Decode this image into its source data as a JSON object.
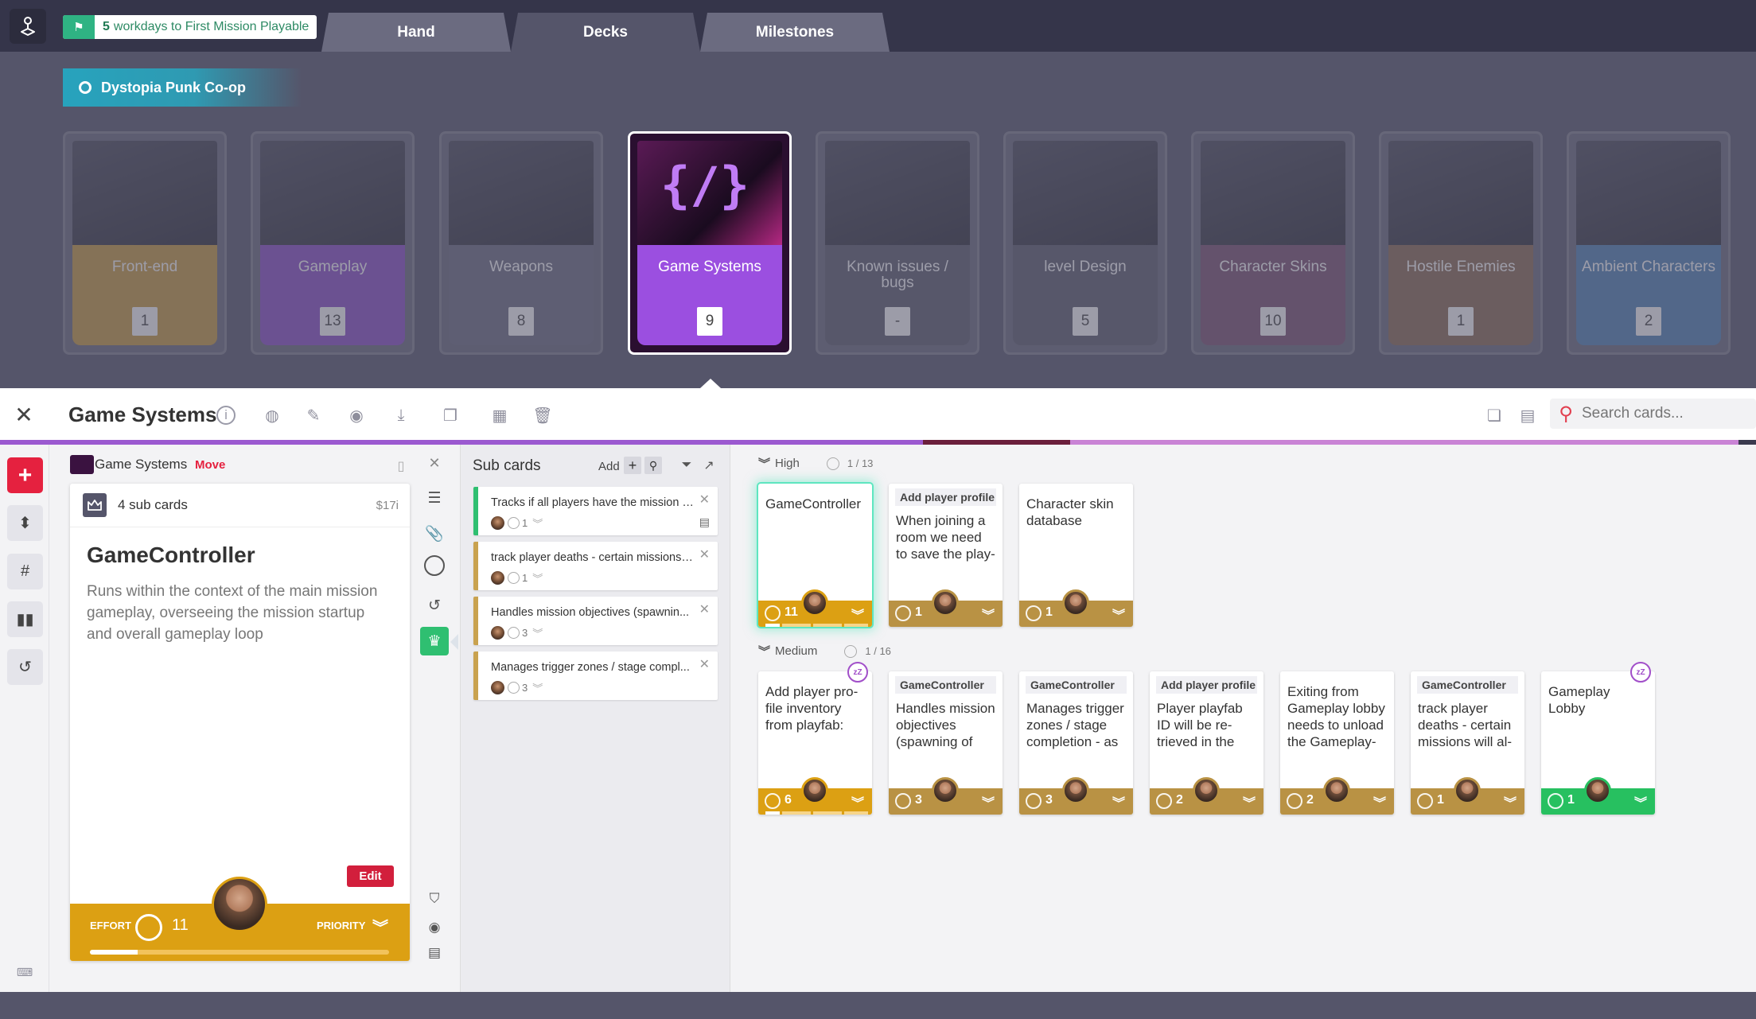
{
  "topbar": {
    "deadline_count": "5",
    "deadline_text": "workdays to First Mission Playable",
    "tabs": [
      {
        "label": "Hand",
        "active": false
      },
      {
        "label": "Decks",
        "active": true
      },
      {
        "label": "Milestones",
        "active": false
      }
    ]
  },
  "project": {
    "name": "Dystopia Punk Co-op"
  },
  "decks": [
    {
      "label": "Front-end",
      "count": "1",
      "color": "#c99b3d",
      "active": false
    },
    {
      "label": "Gameplay",
      "count": "13",
      "color": "#8a4cc8",
      "active": false
    },
    {
      "label": "Weapons",
      "count": "8",
      "color": "#6b6b80",
      "active": false
    },
    {
      "label": "Game Systems",
      "count": "9",
      "color": "#9b4fe0",
      "active": true
    },
    {
      "label": "Known issues / bugs",
      "count": "-",
      "color": "#5a5a6c",
      "active": false
    },
    {
      "label": "level Design",
      "count": "5",
      "color": "#5a5a6c",
      "active": false
    },
    {
      "label": "Character Skins",
      "count": "10",
      "color": "#7a5070",
      "active": false
    },
    {
      "label": "Hostile Enemies",
      "count": "1",
      "color": "#8a6a50",
      "active": false
    },
    {
      "label": "Ambient Characters",
      "count": "2",
      "color": "#4f82b5",
      "active": false
    }
  ],
  "panel": {
    "title": "Game Systems",
    "search_placeholder": "Search cards..."
  },
  "detail": {
    "deck_name": "Game Systems",
    "move_label": "Move",
    "subcard_count": "4 sub cards",
    "cost": "$17i",
    "title": "GameController",
    "description": "Runs within the context of the main mission gameplay, overseeing the mission startup and overall gameplay loop",
    "edit_label": "Edit",
    "effort_label": "EFFORT",
    "effort_value": "11",
    "priority_label": "PRIORITY",
    "progress": 0.16
  },
  "subcards": {
    "title": "Sub cards",
    "add_label": "Add",
    "items": [
      {
        "text": "Tracks if all players have the mission s...",
        "effort": "1",
        "color": "#2fbf71"
      },
      {
        "text": "track player deaths - certain missions ...",
        "effort": "1",
        "color": "#c9a24f"
      },
      {
        "text": "Handles mission objectives (spawnin...",
        "effort": "3",
        "color": "#c9a24f"
      },
      {
        "text": "Manages trigger zones / stage compl...",
        "effort": "3",
        "color": "#c9a24f"
      }
    ]
  },
  "board": {
    "groups": [
      {
        "name": "High",
        "count": "1 / 13",
        "cards": [
          {
            "tag": "",
            "text": "GameController",
            "effort": "11",
            "bar": "gold",
            "selected": true,
            "snooze": false,
            "progress": true
          },
          {
            "tag": "Add player profile ir",
            "text": "When joining a room we need to save the play-",
            "effort": "1",
            "bar": "dim",
            "selected": false,
            "snooze": false,
            "progress": false
          },
          {
            "tag": "",
            "text": "Character skin database",
            "effort": "1",
            "bar": "dim",
            "selected": false,
            "snooze": false,
            "progress": false
          }
        ]
      },
      {
        "name": "Medium",
        "count": "1 / 16",
        "cards": [
          {
            "tag": "",
            "text": "Add player pro-file inventory from playfab:",
            "effort": "6",
            "bar": "gold",
            "selected": false,
            "snooze": true,
            "progress": true
          },
          {
            "tag": "GameController",
            "text": "Handles mission objectives (spawning of",
            "effort": "3",
            "bar": "dim",
            "selected": false,
            "snooze": false,
            "progress": false
          },
          {
            "tag": "GameController",
            "text": "Manages trigger zones / stage completion - as",
            "effort": "3",
            "bar": "dim",
            "selected": false,
            "snooze": false,
            "progress": false
          },
          {
            "tag": "Add player profile ir",
            "text": "Player playfab ID will be re-trieved in the",
            "effort": "2",
            "bar": "dim",
            "selected": false,
            "snooze": false,
            "progress": false
          },
          {
            "tag": "",
            "text": "Exiting from Gameplay lobby needs to unload the Gameplay-",
            "effort": "2",
            "bar": "dim",
            "selected": false,
            "snooze": false,
            "progress": false
          },
          {
            "tag": "GameController",
            "text": "track player deaths - certain missions will al-",
            "effort": "1",
            "bar": "dim",
            "selected": false,
            "snooze": false,
            "progress": false
          },
          {
            "tag": "",
            "text": "Gameplay Lobby",
            "effort": "1",
            "bar": "green",
            "selected": false,
            "snooze": true,
            "progress": false
          }
        ]
      }
    ]
  }
}
